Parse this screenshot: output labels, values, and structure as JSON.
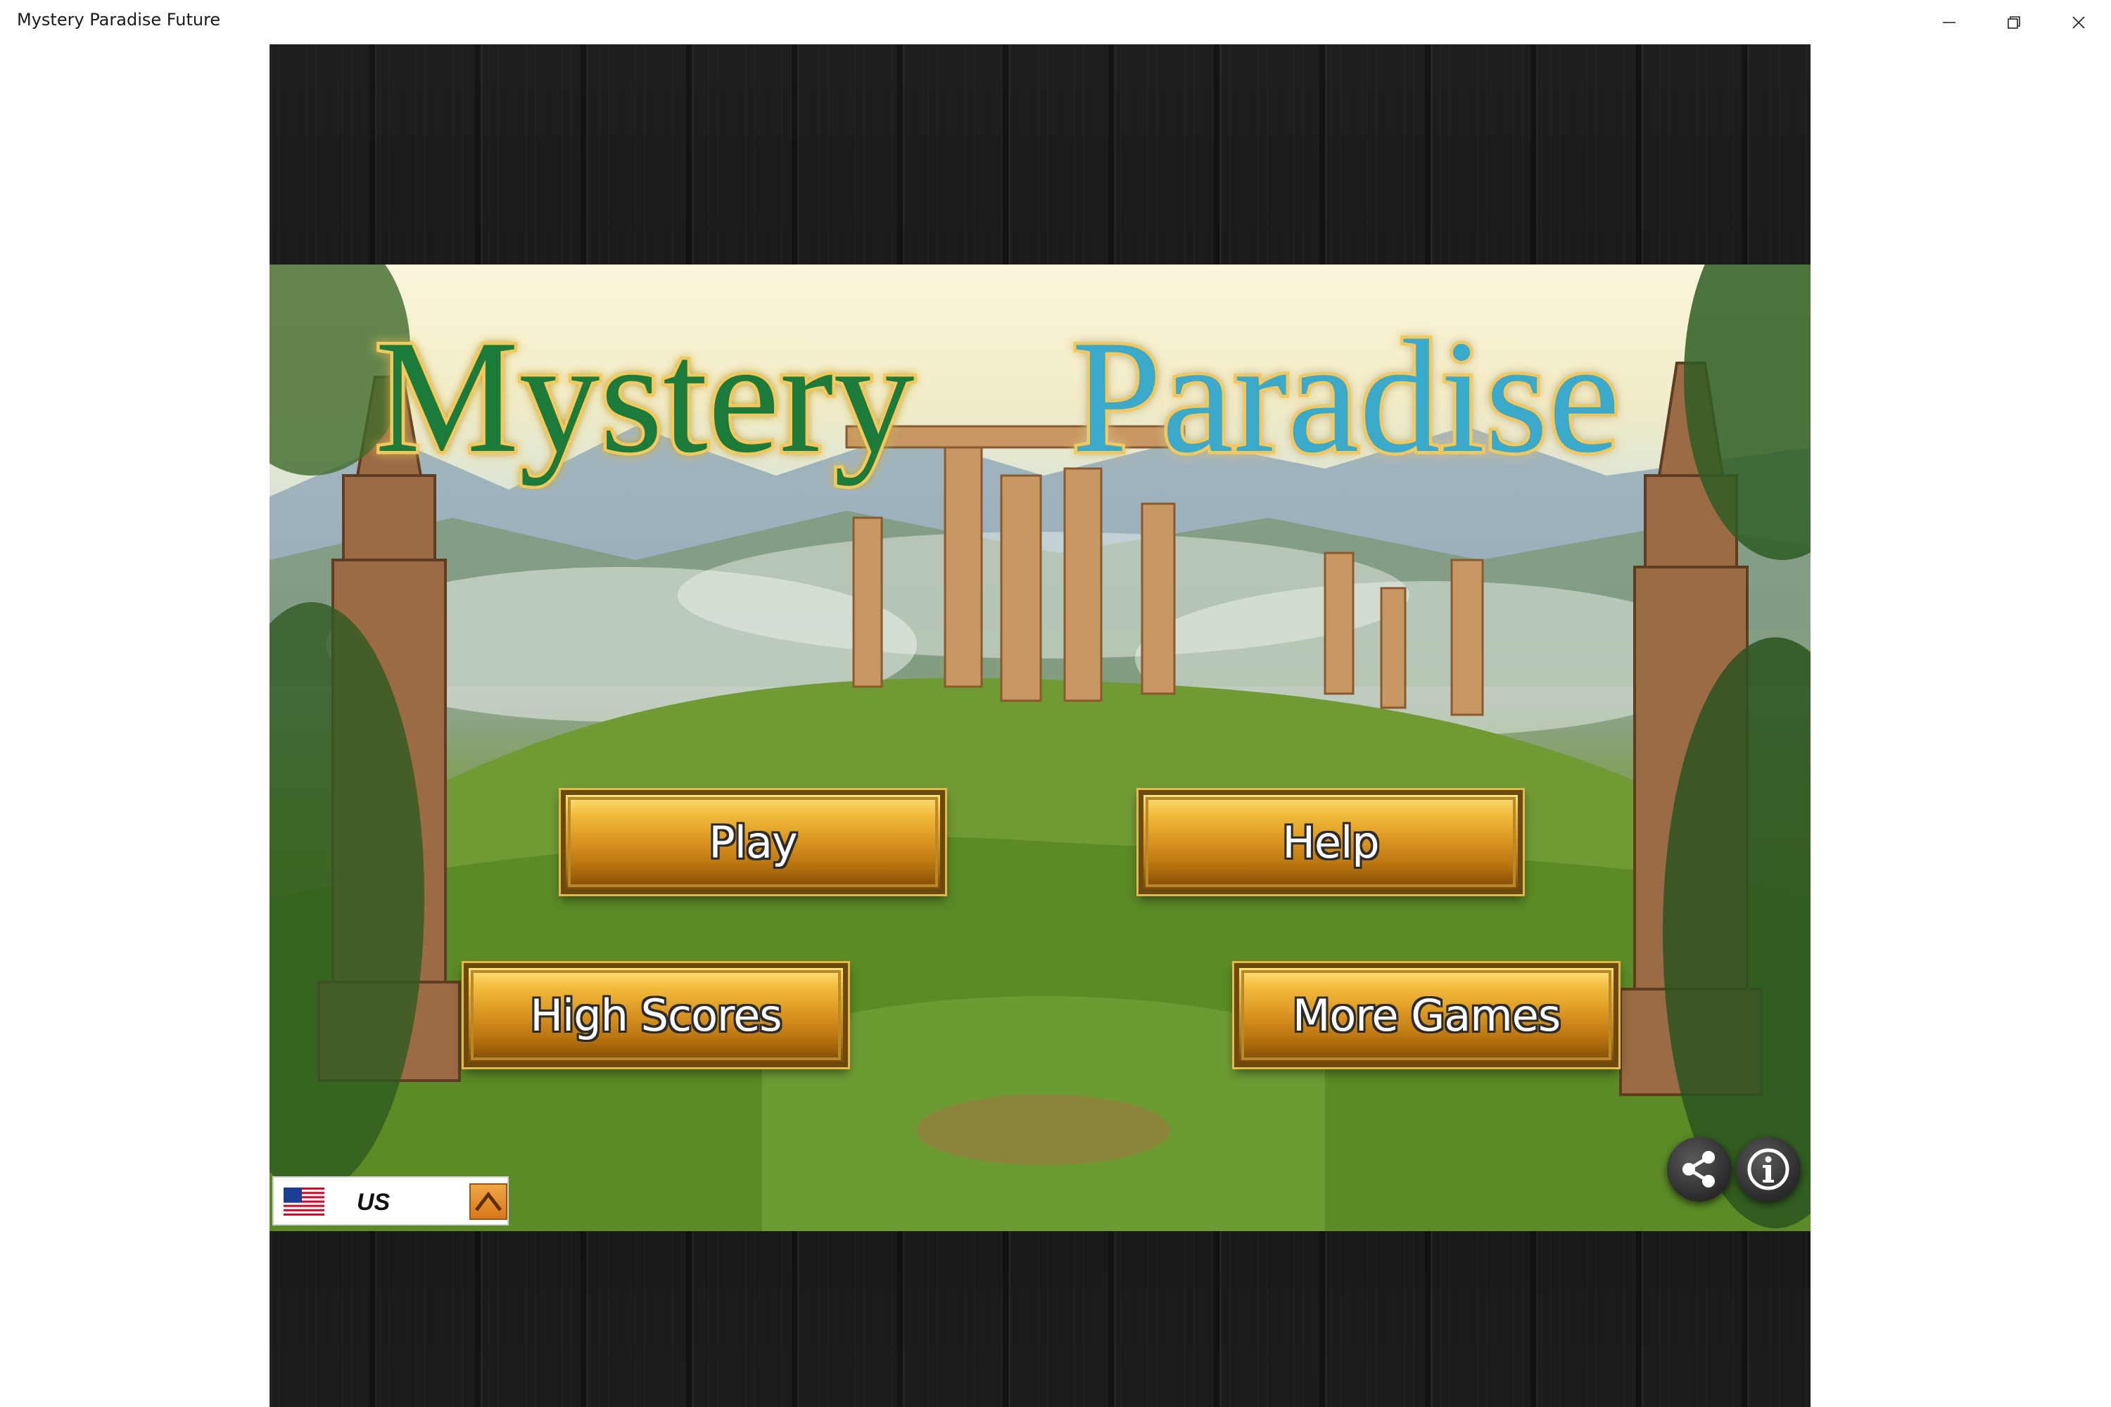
{
  "window": {
    "title": "Mystery Paradise Future",
    "controls": {
      "minimize_icon": "minimize-icon",
      "maximize_icon": "restore-icon",
      "close_icon": "close-icon"
    }
  },
  "game": {
    "logo": {
      "word1": "Mystery",
      "word2": "Paradise",
      "word1_color": "#1f7a3a",
      "word2_color": "#3aa9c9"
    },
    "menu": {
      "play": "Play",
      "help": "Help",
      "high_scores": "High Scores",
      "more_games": "More Games"
    },
    "region": {
      "flag_icon": "us-flag-icon",
      "code": "US",
      "arrow_icon": "chevron-up-icon"
    },
    "share_icon": "share-icon",
    "info_icon": "info-icon",
    "colors": {
      "button_gold": "#d99320",
      "button_border": "#6b4a12",
      "wood_dark": "#1a1a1a"
    }
  }
}
